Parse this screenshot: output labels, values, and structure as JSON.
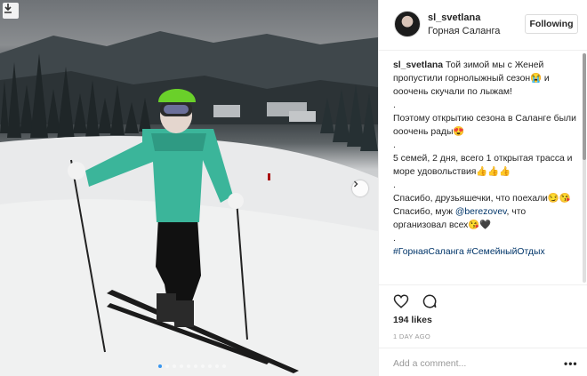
{
  "post": {
    "username": "sl_svetlana",
    "location": "Горная Саланга",
    "follow_label": "Following"
  },
  "caption": {
    "username": "sl_svetlana",
    "line1": "Той зимой мы с Женей пропустили горнолыжный сезон😭 и ооочень скучали по лыжам!",
    "dot1": ".",
    "line2": "Поэтому открытию сезона в Саланге были ооочень рады😍",
    "dot2": ".",
    "line3": "5 семей, 2 дня, всего 1 открытая трасса и море удовольствия👍👍👍",
    "dot3": ".",
    "line4": "Спасибо, друзьяшечки, что поехали😏😘",
    "line5_pre": "Спасибо, муж ",
    "line5_mention": "@berezovev",
    "line5_post": ", что организовал всех😘🖤",
    "dot4": ".",
    "hashtags": "#ГорнаяСаланга #СемейныйОтдых"
  },
  "actions": {
    "likes": "194 likes",
    "date": "1 DAY AGO",
    "comment_placeholder": "Add a comment...",
    "more": "•••"
  },
  "icons": {
    "download": "download-icon",
    "next": "chevron-right-icon",
    "like": "heart-icon",
    "comment": "comment-icon"
  },
  "carousel": {
    "slides": 10,
    "current": 1
  },
  "colors": {
    "link": "#003569",
    "active_dot": "#3897f0",
    "jacket": "#3bb59a",
    "helmet": "#6ad02a"
  }
}
